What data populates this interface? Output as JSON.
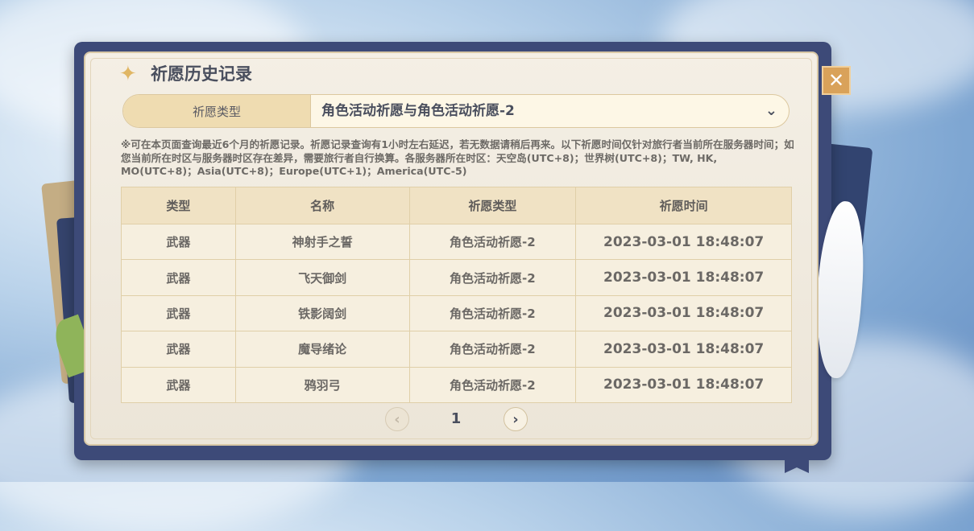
{
  "window": {
    "title": "祈愿历史记录",
    "close_icon": "close-icon"
  },
  "filter": {
    "label": "祈愿类型",
    "selected": "角色活动祈愿与角色活动祈愿-2"
  },
  "notice": "※可在本页面查询最近6个月的祈愿记录。祈愿记录查询有1小时左右延迟，若无数据请稍后再来。以下祈愿时间仅针对旅行者当前所在服务器时间；如您当前所在时区与服务器时区存在差异，需要旅行者自行换算。各服务器所在时区：天空岛(UTC+8)；世界树(UTC+8)；TW, HK, MO(UTC+8)；Asia(UTC+8)；Europe(UTC+1)；America(UTC-5)",
  "table": {
    "headers": [
      "类型",
      "名称",
      "祈愿类型",
      "祈愿时间"
    ],
    "rows": [
      [
        "武器",
        "神射手之誓",
        "角色活动祈愿-2",
        "2023-03-01 18:48:07"
      ],
      [
        "武器",
        "飞天御剑",
        "角色活动祈愿-2",
        "2023-03-01 18:48:07"
      ],
      [
        "武器",
        "铁影阔剑",
        "角色活动祈愿-2",
        "2023-03-01 18:48:07"
      ],
      [
        "武器",
        "魔导绪论",
        "角色活动祈愿-2",
        "2023-03-01 18:48:07"
      ],
      [
        "武器",
        "鸦羽弓",
        "角色活动祈愿-2",
        "2023-03-01 18:48:07"
      ]
    ]
  },
  "pagination": {
    "current_page": "1"
  },
  "colors": {
    "accent_gold": "#d9a25a",
    "panel_bg": "#f4efe5",
    "text_dark": "#4a4f5e"
  }
}
